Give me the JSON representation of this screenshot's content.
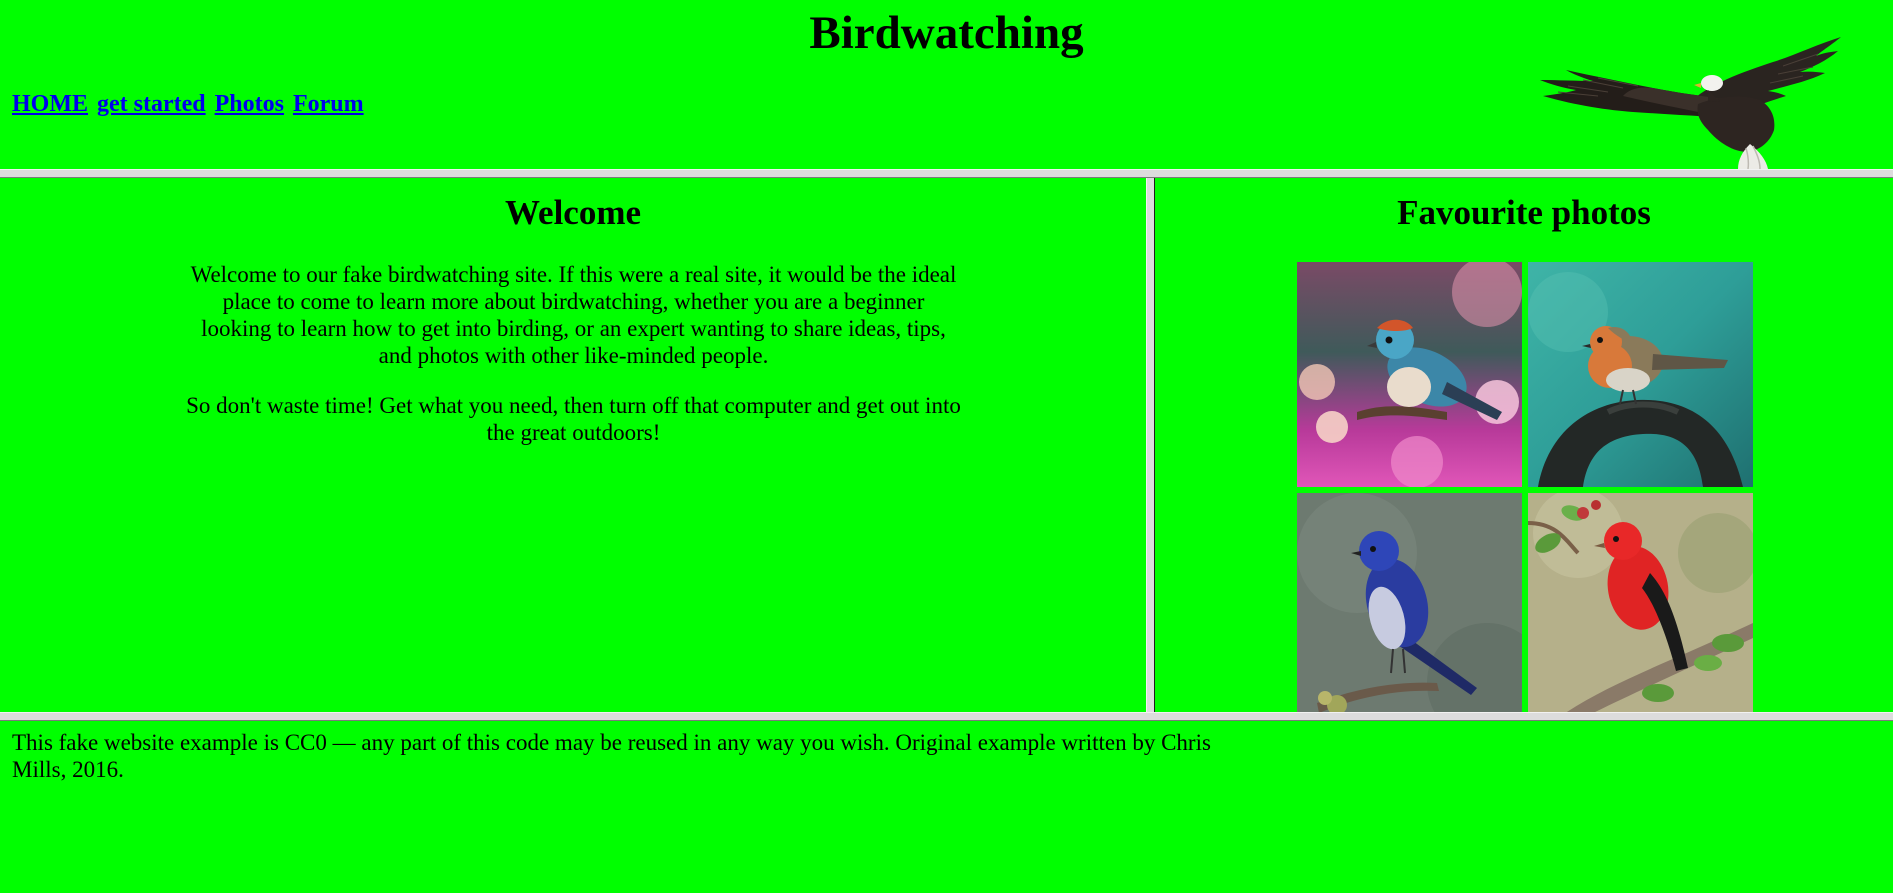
{
  "header": {
    "title": "Birdwatching",
    "nav": [
      {
        "label": "HOME"
      },
      {
        "label": "get started"
      },
      {
        "label": "Photos"
      },
      {
        "label": "Forum"
      }
    ],
    "logo_icon": "eagle-icon"
  },
  "welcome": {
    "heading": "Welcome",
    "paragraphs": [
      "Welcome to our fake birdwatching site. If this were a real site, it would be the ideal place to come to learn more about birdwatching, whether you are a beginner looking to learn how to get into birding, or an expert wanting to share ideas, tips, and photos with other like-minded people.",
      "So don't waste time! Get what you need, then turn off that computer and get out into the great outdoors!"
    ]
  },
  "photos": {
    "heading": "Favourite photos",
    "thumbnails": [
      {
        "icon": "colorful-finch-photo"
      },
      {
        "icon": "robin-photo"
      },
      {
        "icon": "blue-flycatcher-photo"
      },
      {
        "icon": "red-tanager-photo"
      }
    ]
  },
  "footer": {
    "text": "This fake website example is CC0 — any part of this code may be reused in any way you wish. Original example written by Chris Mills, 2016."
  },
  "colors": {
    "background": "#00ff00",
    "link": "#0000ee",
    "frame_border": "#dcdcdc"
  }
}
